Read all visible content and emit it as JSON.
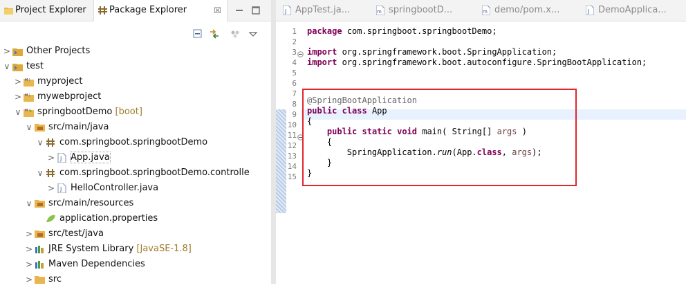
{
  "left_pane": {
    "tabs": [
      {
        "label": "Project Explorer",
        "active": false,
        "icon": "project-explorer-icon"
      },
      {
        "label": "Package Explorer",
        "active": true,
        "icon": "package-explorer-icon",
        "close": "☒"
      }
    ],
    "tree": [
      {
        "label": "Other Projects",
        "twisty": ">",
        "icon": "working-set-icon",
        "depth": 0
      },
      {
        "label": "test",
        "twisty": "∨",
        "icon": "working-set-icon",
        "depth": 0
      },
      {
        "label": "myproject",
        "twisty": ">",
        "icon": "maven-project-icon",
        "depth": 1
      },
      {
        "label": "mywebproject",
        "twisty": ">",
        "icon": "maven-project-icon",
        "depth": 1
      },
      {
        "label": "springbootDemo",
        "decoration": "[boot]",
        "twisty": "∨",
        "icon": "spring-project-icon",
        "depth": 1
      },
      {
        "label": "src/main/java",
        "twisty": "∨",
        "icon": "source-folder-icon",
        "depth": 2
      },
      {
        "label": "com.springboot.springbootDemo",
        "twisty": "∨",
        "icon": "package-icon",
        "depth": 3
      },
      {
        "label": "App.java",
        "twisty": ">",
        "icon": "java-file-icon",
        "depth": 4,
        "selected": true
      },
      {
        "label": "com.springboot.springbootDemo.controlle",
        "twisty": "∨",
        "icon": "package-icon",
        "depth": 3
      },
      {
        "label": "HelloController.java",
        "twisty": ">",
        "icon": "java-file-icon",
        "depth": 4
      },
      {
        "label": "src/main/resources",
        "twisty": "∨",
        "icon": "source-folder-icon",
        "depth": 2
      },
      {
        "label": "application.properties",
        "twisty": "",
        "icon": "properties-file-icon",
        "depth": 3
      },
      {
        "label": "src/test/java",
        "twisty": ">",
        "icon": "source-folder-icon",
        "depth": 2
      },
      {
        "label": "JRE System Library",
        "decoration": "[JavaSE-1.8]",
        "twisty": ">",
        "icon": "library-icon",
        "depth": 2
      },
      {
        "label": "Maven Dependencies",
        "twisty": ">",
        "icon": "library-icon",
        "depth": 2
      },
      {
        "label": "src",
        "twisty": ">",
        "icon": "folder-icon",
        "depth": 2
      }
    ]
  },
  "editor": {
    "tabs": [
      {
        "label": "AppTest.ja...",
        "icon": "java-file-icon"
      },
      {
        "label": "springbootD...",
        "icon": "maven-pom-icon"
      },
      {
        "label": "demo/pom.x...",
        "icon": "maven-pom-icon"
      },
      {
        "label": "DemoApplica...",
        "icon": "java-file-icon"
      }
    ],
    "line_numbers": [
      "1",
      "2",
      "3",
      "4",
      "5",
      "6",
      "7",
      "8",
      "9",
      "10",
      "11",
      "12",
      "13",
      "14",
      "15"
    ],
    "fold_marker": "⊖",
    "code": {
      "l1": {
        "kw": "package",
        "rest": " com.springboot.springbootDemo;"
      },
      "l3": {
        "kw": "import",
        "rest": " org.springframework.boot.SpringApplication;"
      },
      "l4": {
        "kw": "import",
        "rest": " org.springframework.boot.autoconfigure.SpringBootApplication;"
      },
      "l7": {
        "annotation": "@SpringBootApplication"
      },
      "l8": {
        "kw1": "public",
        "kw2": "class",
        "rest": " App"
      },
      "l9": {
        "text": "{"
      },
      "l10": {
        "kw1": "public",
        "kw2": "static",
        "kw3": "void",
        "mid": " main( String[] ",
        "param": "args",
        "end": " )"
      },
      "l11": {
        "text": "{"
      },
      "l12": {
        "pre": "SpringApplication.",
        "method": "run",
        "mid": "(App.",
        "kw": "class",
        "sep": ", ",
        "param": "args",
        "end": ");"
      },
      "l13": {
        "text": "}"
      },
      "l14": {
        "text": "}"
      }
    }
  },
  "colors": {
    "keyword": "#7f0055",
    "highlight_box": "#e0262f",
    "decoration": "#a07b2a"
  }
}
